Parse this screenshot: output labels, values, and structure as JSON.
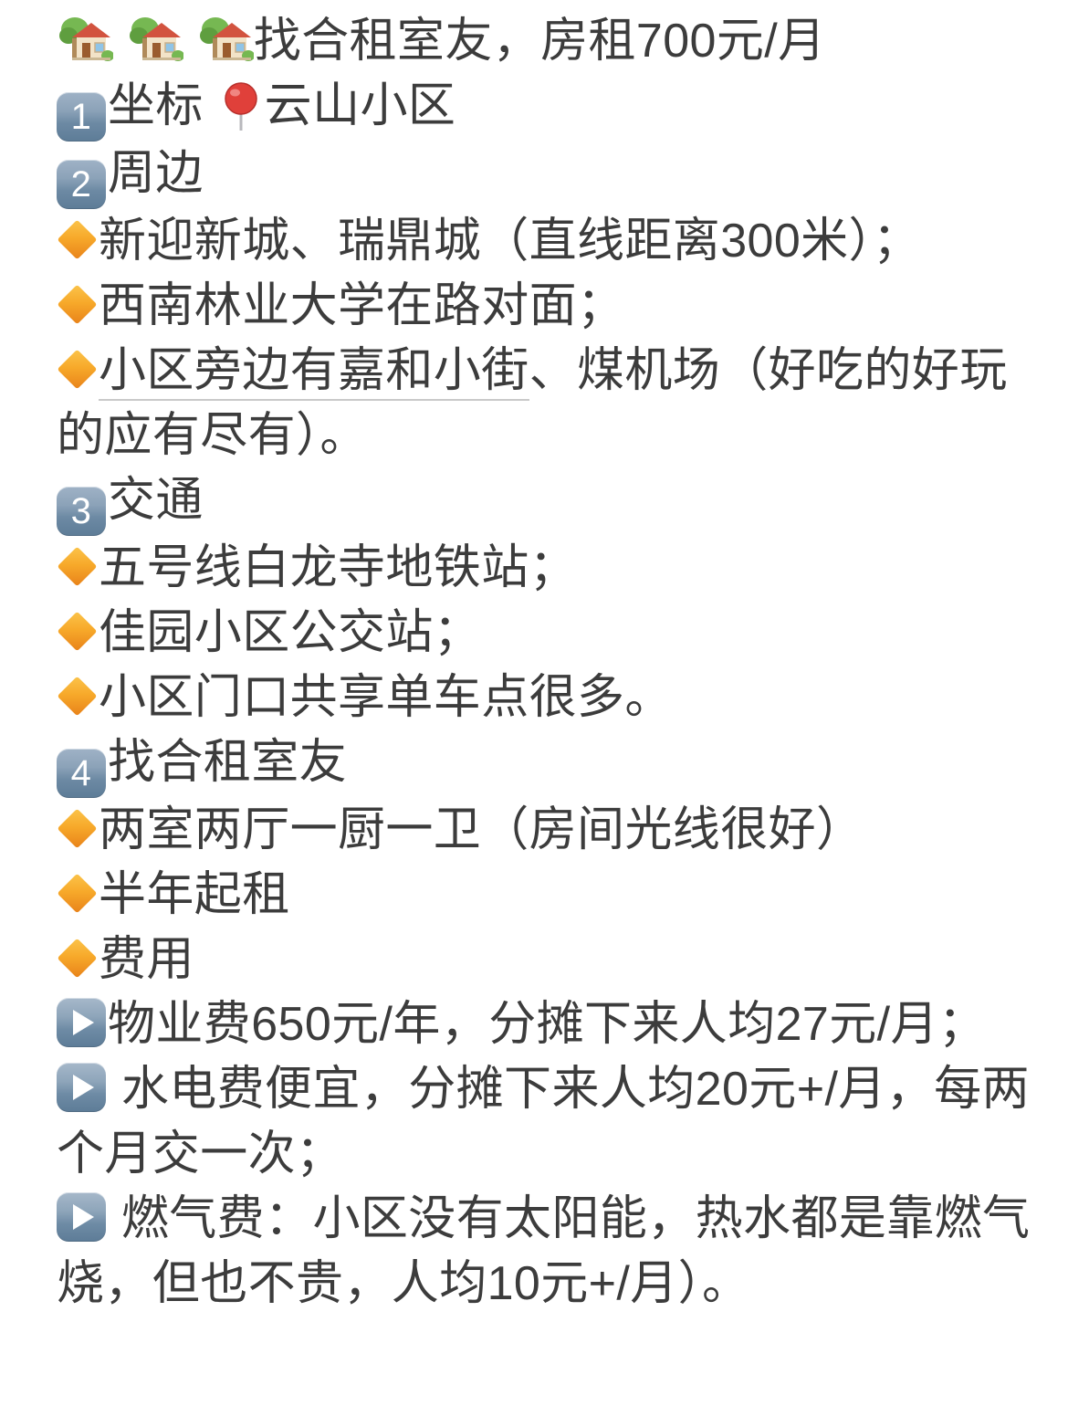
{
  "post": {
    "text_color": "#3c3c3c",
    "background_color": "#ffffff",
    "badge_color": "#6d8aa4",
    "bullet_color": "#f5a623",
    "lines": [
      {
        "id": "title",
        "icon": "house-with-garden-emoji",
        "icon_repeat": 3,
        "text": "找合租室友，房租700元/月"
      },
      {
        "id": "section-1-location",
        "icon": "keycap-digit-one",
        "badge": "1",
        "text_before_pin": "坐标",
        "pin_icon": "round-pushpin-emoji",
        "text_after_pin": "云山小区"
      },
      {
        "id": "section-2-surroundings",
        "icon": "keycap-digit-two",
        "badge": "2",
        "text": "周边"
      },
      {
        "id": "nearby-communities",
        "icon": "small-orange-diamond",
        "text": "新迎新城、瑞鼎城（直线距离300米）；"
      },
      {
        "id": "nearby-university",
        "icon": "small-orange-diamond",
        "text": "西南林业大学在路对面；"
      },
      {
        "id": "nearby-streets",
        "icon": "small-orange-diamond",
        "underlined_text": "小区旁边有嘉和小街",
        "rest_text": "、煤机场（好吃的好玩的应有尽有）。"
      },
      {
        "id": "section-3-transport",
        "icon": "keycap-digit-three",
        "badge": "3",
        "text": "交通"
      },
      {
        "id": "transport-metro",
        "icon": "small-orange-diamond",
        "text": "五号线白龙寺地铁站；"
      },
      {
        "id": "transport-bus",
        "icon": "small-orange-diamond",
        "text": "佳园小区公交站；"
      },
      {
        "id": "transport-bike",
        "icon": "small-orange-diamond",
        "text": "小区门口共享单车点很多。"
      },
      {
        "id": "section-4-roommate",
        "icon": "keycap-digit-four",
        "badge": "4",
        "text": "找合租室友"
      },
      {
        "id": "layout",
        "icon": "small-orange-diamond",
        "text": "两室两厅一厨一卫（房间光线很好）"
      },
      {
        "id": "lease-term",
        "icon": "small-orange-diamond",
        "text": "半年起租"
      },
      {
        "id": "fees-heading",
        "icon": "small-orange-diamond",
        "text": "费用"
      },
      {
        "id": "fee-property",
        "icon": "play-button-emoji",
        "text": "物业费650元/年，分摊下来人均27元/月；"
      },
      {
        "id": "fee-utilities",
        "icon": "play-button-emoji",
        "text": " 水电费便宜，分摊下来人均20元+/月，每两个月交一次；"
      },
      {
        "id": "fee-gas",
        "icon": "play-button-emoji",
        "text": " 燃气费：小区没有太阳能，热水都是靠燃气烧，但也不贵，人均10元+/月）。"
      }
    ]
  }
}
